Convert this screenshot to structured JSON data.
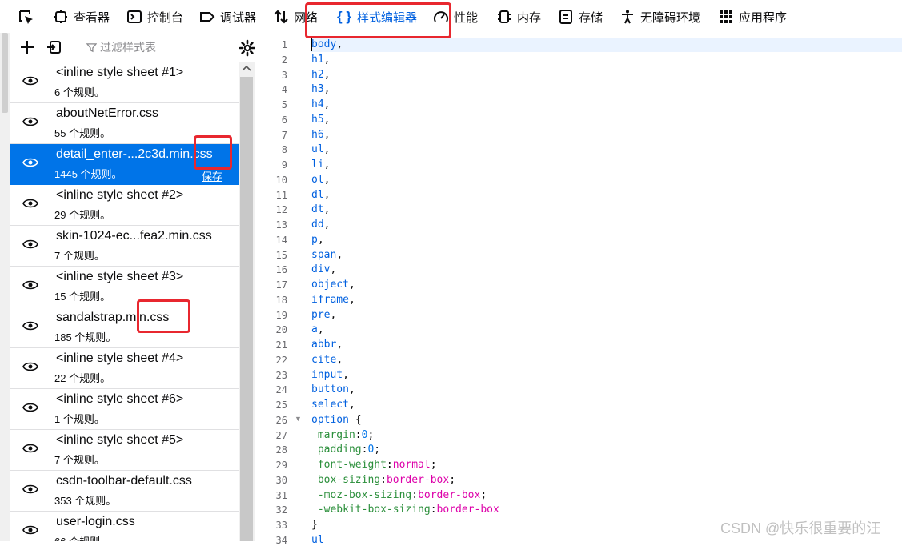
{
  "toolbar": {
    "items": [
      {
        "label": "查看器",
        "icon": "inspector-icon"
      },
      {
        "label": "控制台",
        "icon": "console-icon"
      },
      {
        "label": "调试器",
        "icon": "debugger-icon"
      },
      {
        "label": "网络",
        "icon": "network-icon"
      },
      {
        "label": "样式编辑器",
        "icon": "style-editor-icon",
        "selected": true
      },
      {
        "label": "性能",
        "icon": "performance-icon"
      },
      {
        "label": "内存",
        "icon": "memory-icon"
      },
      {
        "label": "存储",
        "icon": "storage-icon"
      },
      {
        "label": "无障碍环境",
        "icon": "accessibility-icon"
      },
      {
        "label": "应用程序",
        "icon": "application-icon"
      }
    ],
    "accent": "#0060df",
    "highlight": "#e8272f"
  },
  "side": {
    "filter_placeholder": "过滤样式表",
    "sheets": [
      {
        "name": "<inline style sheet #1>",
        "rules": "6 个规则。"
      },
      {
        "name": "aboutNetError.css",
        "rules": "55 个规则。"
      },
      {
        "name": "detail_enter-...2c3d.min.css",
        "rules": "1445 个规则。",
        "selected": true,
        "save": "保存"
      },
      {
        "name": "<inline style sheet #2>",
        "rules": "29 个规则。"
      },
      {
        "name": "skin-1024-ec...fea2.min.css",
        "rules": "7 个规则。"
      },
      {
        "name": "<inline style sheet #3>",
        "rules": "15 个规则。"
      },
      {
        "name": "sandalstrap.min.css",
        "rules": "185 个规则。"
      },
      {
        "name": "<inline style sheet #4>",
        "rules": "22 个规则。"
      },
      {
        "name": "<inline style sheet #6>",
        "rules": "1 个规则。"
      },
      {
        "name": "<inline style sheet #5>",
        "rules": "7 个规则。"
      },
      {
        "name": "csdn-toolbar-default.css",
        "rules": "353 个规则。"
      },
      {
        "name": "user-login.css",
        "rules": "66 个规则。"
      }
    ]
  },
  "editor": {
    "lines": [
      "body,",
      "h1,",
      "h2,",
      "h3,",
      "h4,",
      "h5,",
      "h6,",
      "ul,",
      "li,",
      "ol,",
      "dl,",
      "dt,",
      "dd,",
      "p,",
      "span,",
      "div,",
      "object,",
      "iframe,",
      "pre,",
      "a,",
      "abbr,",
      "cite,",
      "input,",
      "button,",
      "select,",
      "option {",
      " margin:0;",
      " padding:0;",
      " font-weight:normal;",
      " box-sizing:border-box;",
      " -moz-box-sizing:border-box;",
      " -webkit-box-sizing:border-box",
      "}",
      "ul"
    ]
  },
  "watermark": "CSDN @快乐很重要的汪"
}
